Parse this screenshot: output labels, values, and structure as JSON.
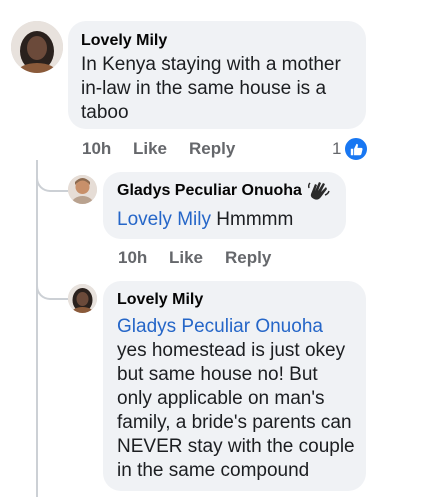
{
  "comment1": {
    "author": "Lovely Mily",
    "lines": [
      "In Kenya staying with a mother",
      "in-law in the same house is a",
      "taboo"
    ],
    "time": "10h",
    "like_label": "Like",
    "reply_label": "Reply",
    "reaction_count": "1",
    "reaction_icon": "thumbs-up-icon",
    "reaction_color": "#1877f2"
  },
  "reply1": {
    "author": "Gladys Peculiar Onuoha",
    "mention": "Lovely Mily",
    "text": "Hmmmm",
    "badge_icon": "hand-emoji-icon",
    "time": "10h",
    "like_label": "Like",
    "reply_label": "Reply"
  },
  "reply2": {
    "author": "Lovely Mily",
    "mention": "Gladys Peculiar Onuoha",
    "lines": [
      "yes homestead is just okey",
      "but same house no! But",
      "only applicable on man's",
      "family, a bride's parents can",
      "NEVER stay with the couple",
      "in the same compound"
    ]
  },
  "colors": {
    "mention": "#2566c8",
    "bubble": "#f0f2f5",
    "meta": "#65676b"
  }
}
